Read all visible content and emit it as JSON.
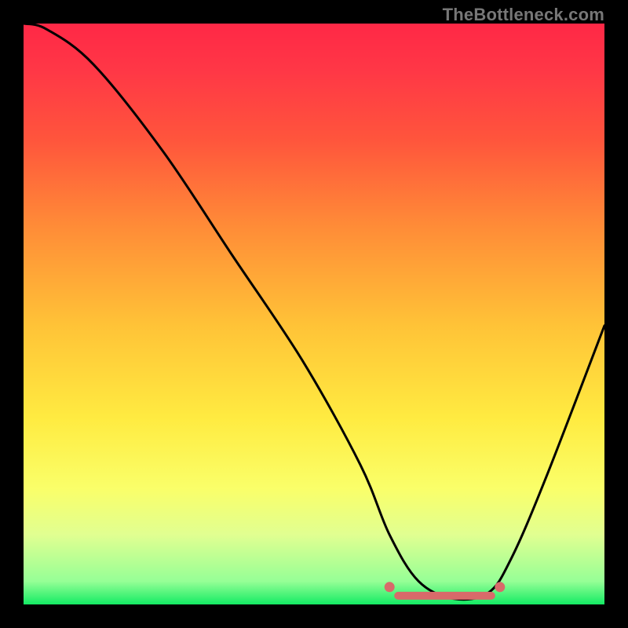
{
  "attribution": "TheBottleneck.com",
  "chart_data": {
    "type": "line",
    "title": "",
    "xlabel": "",
    "ylabel": "",
    "xlim": [
      0,
      100
    ],
    "ylim": [
      0,
      100
    ],
    "series": [
      {
        "name": "bottleneck-curve",
        "x": [
          0,
          4,
          12,
          24,
          36,
          48,
          58,
          63,
          68,
          74,
          80,
          84,
          90,
          100
        ],
        "values": [
          100,
          99,
          93,
          78,
          60,
          42,
          24,
          12,
          4,
          1,
          2,
          8,
          22,
          48
        ]
      }
    ],
    "annotations": [
      {
        "name": "optimal-band-left-dot",
        "x": 63,
        "y": 3
      },
      {
        "name": "optimal-band-right-dot",
        "x": 82,
        "y": 3
      },
      {
        "name": "optimal-band-bar",
        "x": 72,
        "y": 1.5
      }
    ],
    "colors": {
      "curve": "#000000",
      "optimal_dot": "#d86a6a",
      "optimal_bar": "#d86a6a"
    }
  }
}
